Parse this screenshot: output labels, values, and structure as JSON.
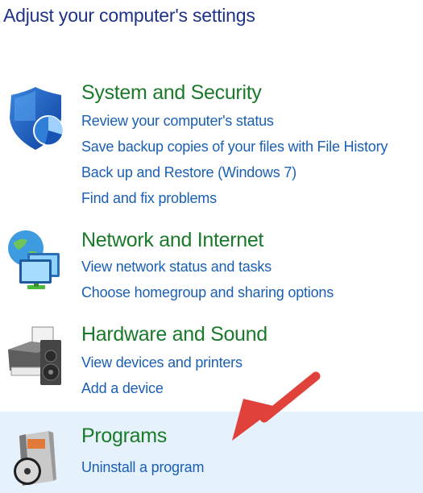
{
  "page": {
    "title": "Adjust your computer's settings"
  },
  "categories": [
    {
      "title": "System and Security",
      "icon": "shield-icon",
      "links": [
        "Review your computer's status",
        "Save backup copies of your files with File History",
        "Back up and Restore (Windows 7)",
        "Find and fix problems"
      ]
    },
    {
      "title": "Network and Internet",
      "icon": "network-globe-icon",
      "links": [
        "View network status and tasks",
        "Choose homegroup and sharing options"
      ]
    },
    {
      "title": "Hardware and Sound",
      "icon": "printer-speaker-icon",
      "links": [
        "View devices and printers",
        "Add a device"
      ]
    },
    {
      "title": "Programs",
      "icon": "programs-disc-icon",
      "highlighted": true,
      "links": [
        "Uninstall a program"
      ]
    }
  ],
  "annotation": {
    "arrow_color": "#e0413a",
    "arrow": "red-arrow-icon"
  },
  "colors": {
    "title": "#1e3287",
    "category": "#1a7a2a",
    "link": "#1a5fb4",
    "highlight": "#e5f1fb"
  }
}
